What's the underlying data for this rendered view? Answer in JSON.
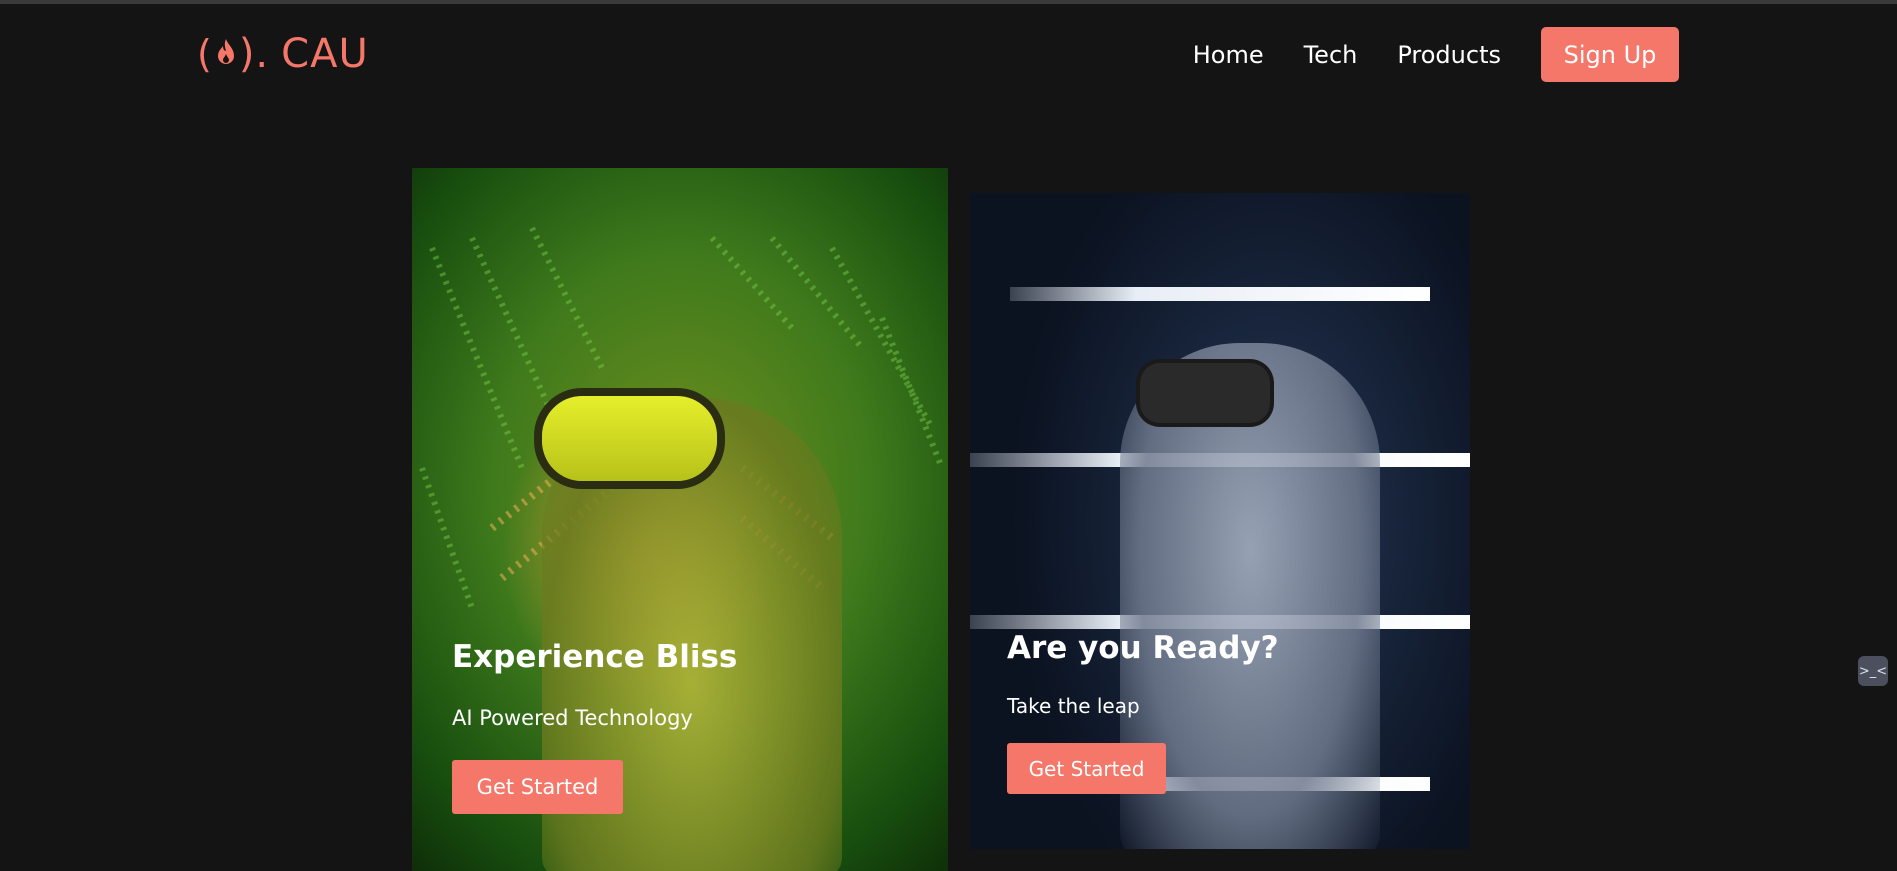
{
  "brand": {
    "logo_text": "CAU",
    "logo_prefix": "(",
    "logo_suffix": ").",
    "logo_icon": "flame-icon",
    "accent_color": "#f5776a"
  },
  "nav": {
    "links": [
      "Home",
      "Tech",
      "Products"
    ],
    "signup_label": "Sign Up"
  },
  "cards": [
    {
      "title": "Experience Bliss",
      "subtitle": "AI Powered Technology",
      "button_label": "Get Started"
    },
    {
      "title": "Are you Ready?",
      "subtitle": "Take the leap",
      "button_label": "Get Started"
    }
  ],
  "widget": {
    "icon": "code-icon",
    "label": ">_<"
  }
}
